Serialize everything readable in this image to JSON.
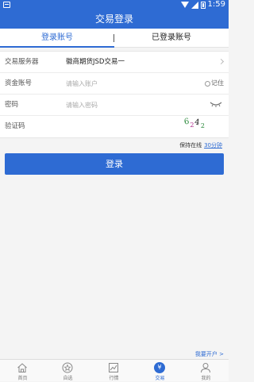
{
  "status_bar": {
    "time": "1:59"
  },
  "header": {
    "title": "交易登录"
  },
  "tabs": [
    {
      "label": "登录账号",
      "active": true
    },
    {
      "label": "已登录账号",
      "active": false
    }
  ],
  "form": {
    "server": {
      "label": "交易服务器",
      "value": "徽商期货JSD交易一"
    },
    "account": {
      "label": "资金账号",
      "placeholder": "请输入账户",
      "remember_label": "记住"
    },
    "password": {
      "label": "密码",
      "placeholder": "请输入密码"
    },
    "captcha": {
      "label": "验证码",
      "code": [
        "6",
        "2",
        "4",
        "2"
      ]
    }
  },
  "keep_online": {
    "label": "保持在线",
    "duration": "30分钟"
  },
  "login_button": {
    "label": "登录"
  },
  "open_account": {
    "label": "我要开户 >"
  },
  "bottom_nav": [
    {
      "label": "首页",
      "icon": "home-icon"
    },
    {
      "label": "自选",
      "icon": "star-icon"
    },
    {
      "label": "行情",
      "icon": "chart-icon"
    },
    {
      "label": "交易",
      "icon": "trade-icon",
      "active": true
    },
    {
      "label": "我的",
      "icon": "user-icon"
    }
  ],
  "colors": {
    "accent": "#2e6bd3",
    "captcha": [
      "#2c8a3c",
      "#b0308f",
      "#1a1a1a",
      "#2c8a3c"
    ]
  }
}
